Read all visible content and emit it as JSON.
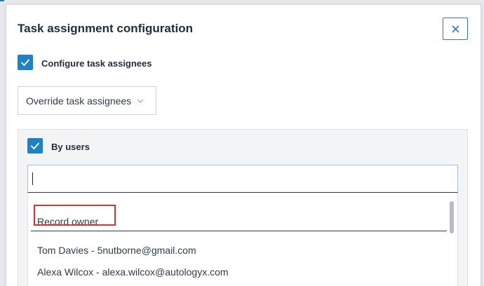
{
  "dialog": {
    "title": "Task assignment configuration"
  },
  "configure": {
    "label": "Configure task assignees",
    "checked": true
  },
  "assignee_mode": {
    "selected": "Override task assignees"
  },
  "by_users": {
    "label": "By users",
    "checked": true,
    "search_value": ""
  },
  "options": {
    "record_owner": "Record owner",
    "users": [
      "Tom Davies - 5nutborne@gmail.com",
      "Alexa Wilcox - alexa.wilcox@autologyx.com"
    ]
  },
  "colors": {
    "accent": "#1f82c8",
    "highlight": "#d9312f"
  },
  "icons": {
    "close": "close-icon",
    "checkmark": "checkmark-icon",
    "chevron": "chevron-down-icon"
  }
}
